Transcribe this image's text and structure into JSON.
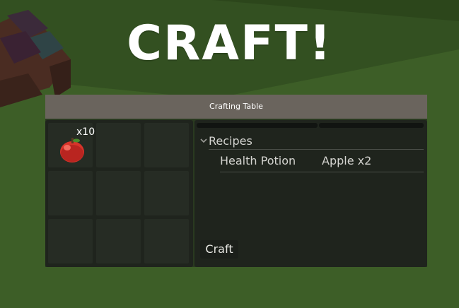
{
  "title": "CRAFT!",
  "window": {
    "header": "Crafting Table"
  },
  "inventory": {
    "slots": [
      {
        "item": "apple",
        "count": "x10"
      },
      {},
      {},
      {},
      {},
      {},
      {},
      {},
      {}
    ]
  },
  "recipes": {
    "root_label": "Recipes",
    "items": [
      {
        "name": "Health Potion",
        "ingredients": "Apple x2"
      }
    ]
  },
  "craft_button": "Craft",
  "colors": {
    "background": "#3a5a26",
    "header": "#6a645d",
    "panel": "#1f241d",
    "slot": "#262c24",
    "apple": "#d8342a"
  }
}
